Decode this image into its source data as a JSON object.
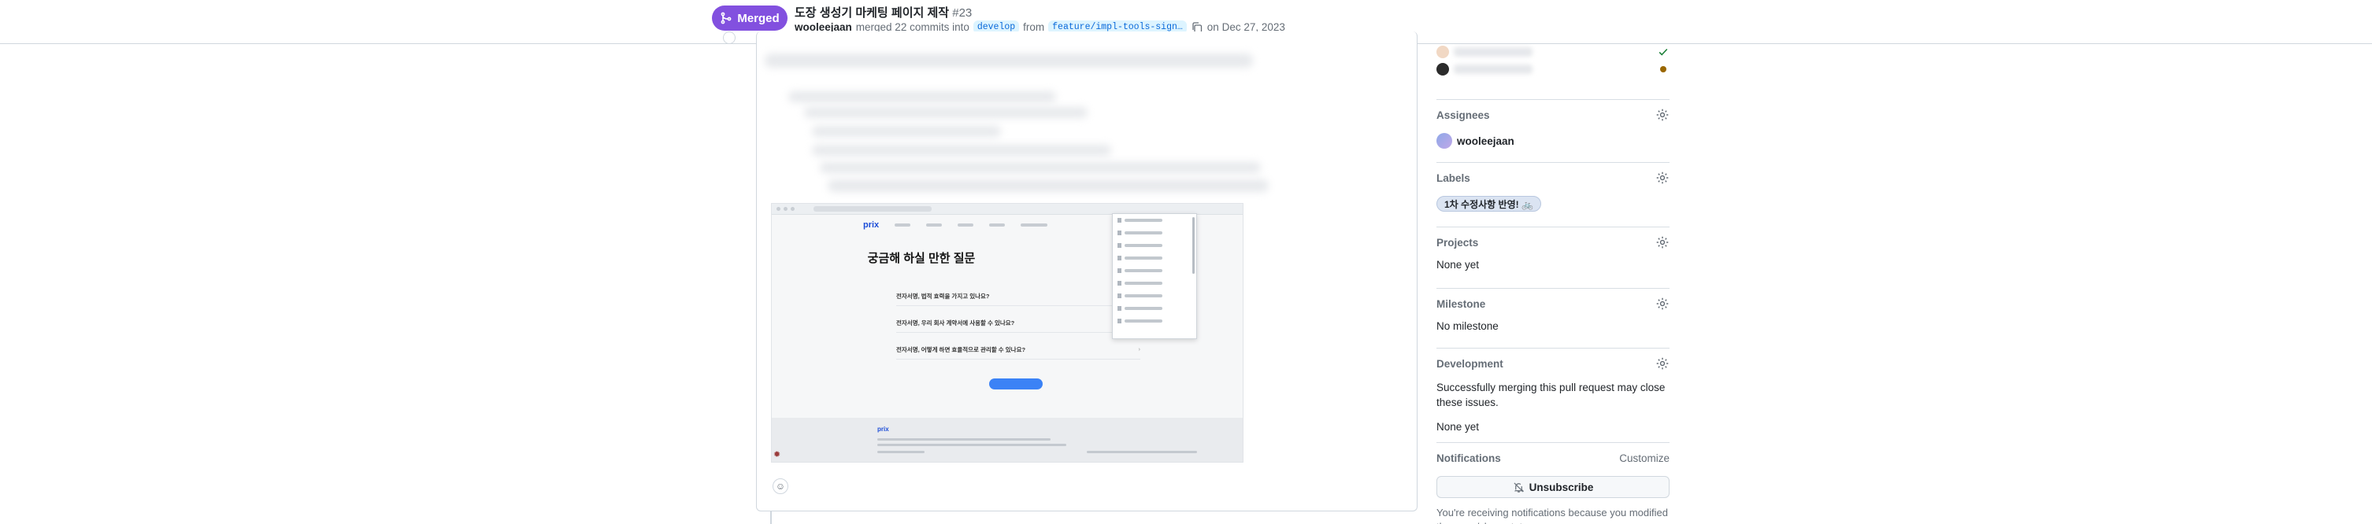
{
  "header": {
    "state_label": "Merged",
    "title": "도장 생성기 마케팅 페이지 제작",
    "number": "#23",
    "author": "wooleejaan",
    "action": "merged 22 commits into",
    "base_branch": "develop",
    "from_word": "from",
    "head_branch": "feature/impl-tools-sign…",
    "date": "on Dec 27, 2023",
    "merged_color": "#8250df"
  },
  "screenshot": {
    "logo": "prix",
    "heading": "궁금해 하실 만한 질문",
    "questions": [
      "전자서명, 법적 효력을 가지고 있나요?",
      "전자서명, 우리 회사 계약서에 사용할 수 있나요?",
      "전자서명, 어떻게 하면 효율적으로 관리할 수 있나요?"
    ],
    "footer_logo": "prix"
  },
  "sidebar": {
    "assignees": {
      "heading": "Assignees",
      "user": "wooleejaan"
    },
    "labels": {
      "heading": "Labels",
      "label": "1차 수정사항 반영! 🚲"
    },
    "projects": {
      "heading": "Projects",
      "value": "None yet"
    },
    "milestone": {
      "heading": "Milestone",
      "value": "No milestone"
    },
    "development": {
      "heading": "Development",
      "text": "Successfully merging this pull request may close these issues.",
      "value": "None yet"
    },
    "notifications": {
      "heading": "Notifications",
      "customize": "Customize",
      "button": "Unsubscribe",
      "note": "You're receiving notifications because you modified the open/close state."
    }
  }
}
